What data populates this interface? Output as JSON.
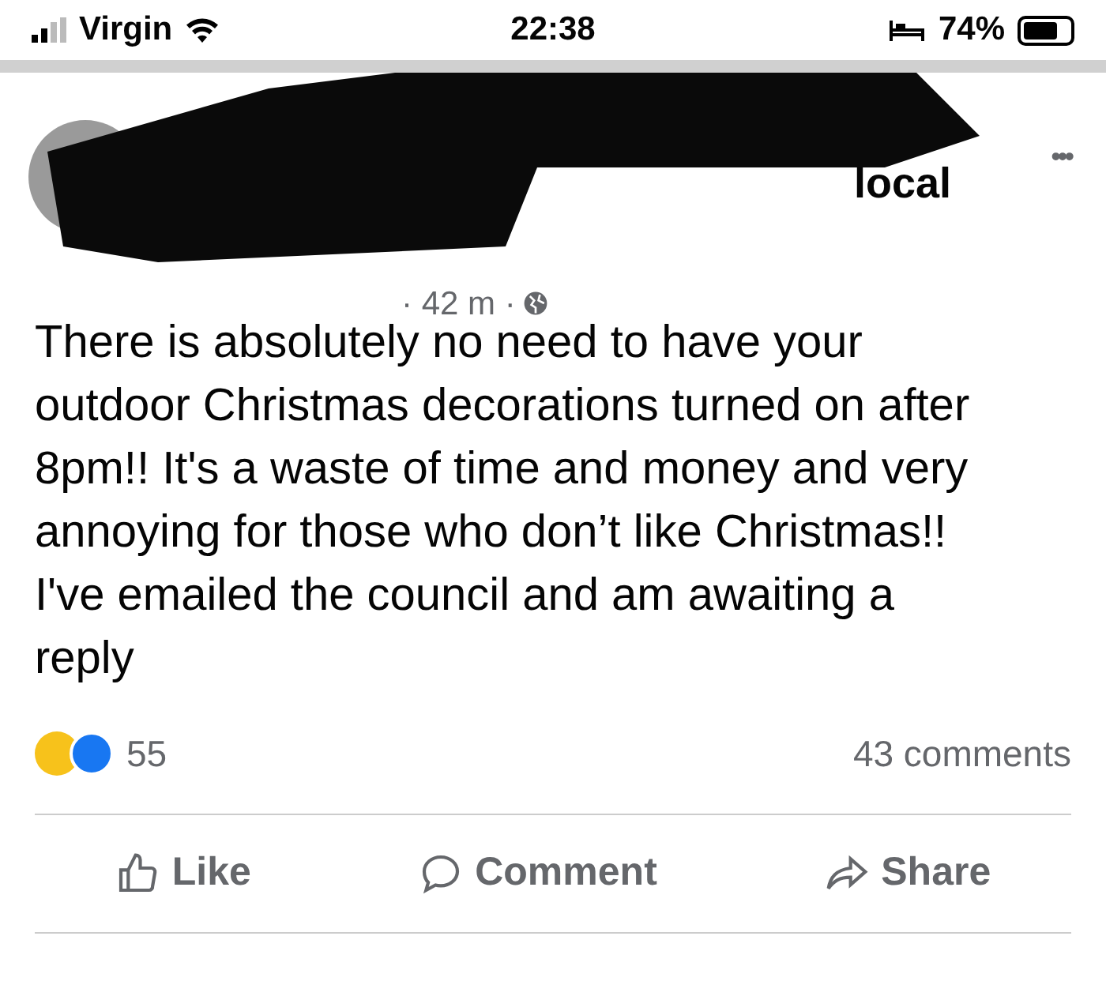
{
  "status_bar": {
    "carrier": "Virgin",
    "time": "22:38",
    "battery": "74%"
  },
  "post": {
    "author_visible": "local",
    "meta": "· 42 m ·",
    "more": "•••",
    "text": "There is absolutely no need to have your outdoor Christmas decorations turned on after 8pm!! It's a waste of time and money and very annoying for those who don’t like Christmas!! I've emailed the council and am awaiting a reply",
    "reaction_count": "55",
    "comments": "43 comments"
  },
  "actions": [
    {
      "kind": "like",
      "label": "Like"
    },
    {
      "kind": "comment",
      "label": "Comment"
    },
    {
      "kind": "share",
      "label": "Share"
    }
  ]
}
